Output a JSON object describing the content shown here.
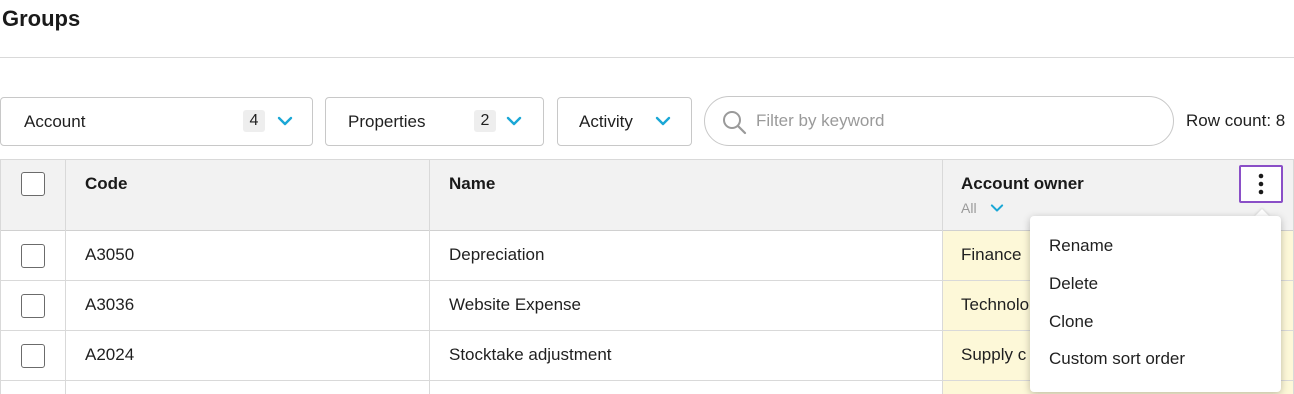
{
  "page": {
    "title": "Groups"
  },
  "filters": [
    {
      "label": "Account",
      "count": "4"
    },
    {
      "label": "Properties",
      "count": "2"
    },
    {
      "label": "Activity"
    }
  ],
  "search": {
    "placeholder": "Filter by keyword",
    "value": ""
  },
  "row_count": "Row count: 8",
  "table": {
    "headers": {
      "code": "Code",
      "name": "Name",
      "owner": "Account owner",
      "owner_filter": "All"
    },
    "rows": [
      {
        "code": "A3050",
        "name": "Depreciation",
        "owner": "Finance"
      },
      {
        "code": "A3036",
        "name": "Website Expense",
        "owner": "Technolo"
      },
      {
        "code": "A2024",
        "name": "Stocktake adjustment",
        "owner": "Supply c"
      }
    ]
  },
  "column_menu": {
    "items": [
      "Rename",
      "Delete",
      "Clone",
      "Custom sort order"
    ]
  },
  "colors": {
    "accent": "#1aa7d6",
    "kebab_border": "#8a4fc7",
    "highlight_column": "#fdf8d8"
  }
}
